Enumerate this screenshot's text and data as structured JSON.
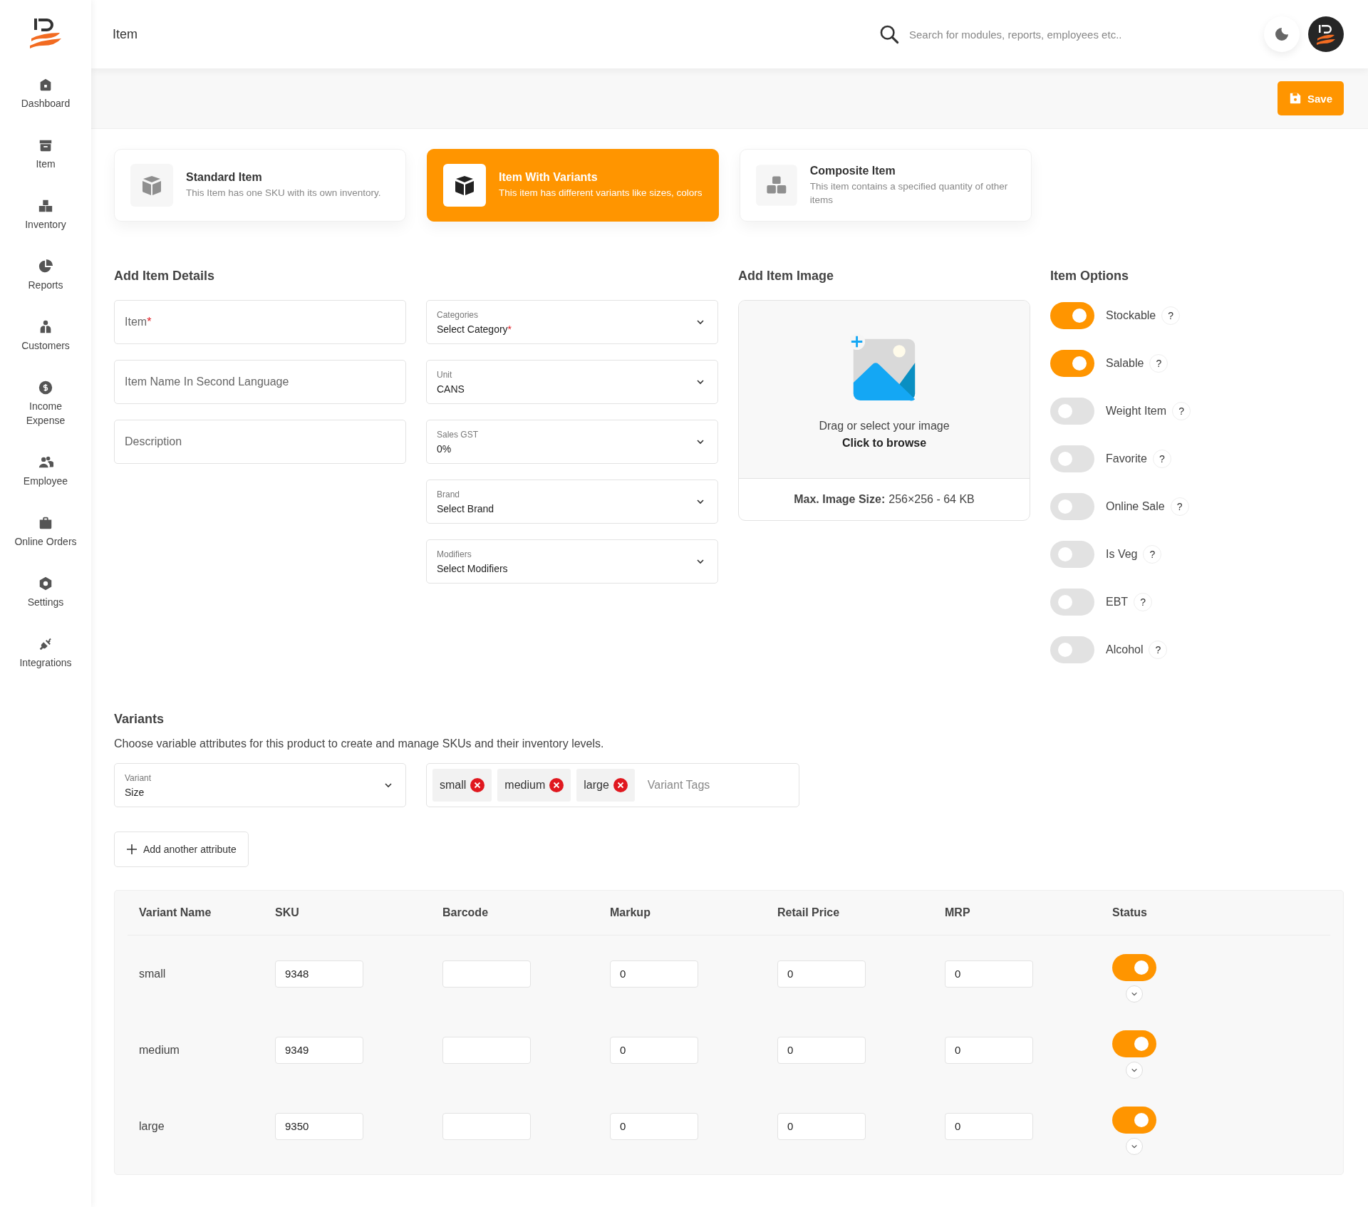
{
  "header": {
    "title": "Item",
    "search": {
      "placeholder": "Search for modules, reports, employees etc.."
    }
  },
  "sidebar": {
    "items": [
      {
        "label": "Dashboard"
      },
      {
        "label": "Item"
      },
      {
        "label": "Inventory"
      },
      {
        "label": "Reports"
      },
      {
        "label": "Customers"
      },
      {
        "label": "Income Expense"
      },
      {
        "label": "Employee"
      },
      {
        "label": "Online Orders"
      },
      {
        "label": "Settings"
      },
      {
        "label": "Integrations"
      }
    ]
  },
  "toolbar": {
    "save_button": "Save"
  },
  "item_types": [
    {
      "title": "Standard Item",
      "description": "This Item has one SKU with its own inventory.",
      "selected": false
    },
    {
      "title": "Item With Variants",
      "description": "This item has different variants like sizes, colors",
      "selected": true
    },
    {
      "title": "Composite Item",
      "description": "This item contains a specified quantity of other items",
      "selected": false
    }
  ],
  "details": {
    "title": "Add Item Details",
    "fields": [
      {
        "placeholder": "Item",
        "mark": "*"
      },
      {
        "placeholder": "Item Name In Second Language"
      },
      {
        "placeholder": "Description"
      }
    ],
    "selects": [
      {
        "label": "Categories",
        "value": "Select Category",
        "mark": "*"
      },
      {
        "label": "Unit",
        "value": "CANS"
      },
      {
        "label": "Sales GST",
        "value": "0%"
      },
      {
        "label": "Brand",
        "value": "Select Brand"
      },
      {
        "label": "Modifiers",
        "value": "Select Modifiers"
      }
    ]
  },
  "image": {
    "title": "Add Item Image",
    "hint": "Drag or select your image",
    "browse": "Click to browse",
    "size_label": "Max. Image Size:",
    "size_value": "256×256 - 64 KB"
  },
  "options": {
    "title": "Item Options",
    "items": [
      {
        "label": "Stockable",
        "on": true,
        "help": "?"
      },
      {
        "label": "Salable",
        "on": true,
        "help": "?"
      },
      {
        "label": "Weight Item",
        "on": false,
        "help": "?"
      },
      {
        "label": "Favorite",
        "on": false,
        "help": "?"
      },
      {
        "label": "Online Sale",
        "on": false,
        "help": "?"
      },
      {
        "label": "Is Veg",
        "on": false,
        "help": "?"
      },
      {
        "label": "EBT",
        "on": false,
        "help": "?"
      },
      {
        "label": "Alcohol",
        "on": false,
        "help": "?"
      }
    ]
  },
  "variants": {
    "title": "Variants",
    "description": "Choose variable attributes for this product to create and manage SKUs and their inventory levels.",
    "attribute": {
      "label": "Variant",
      "value": "Size"
    },
    "tags": [
      {
        "label": "small"
      },
      {
        "label": "medium"
      },
      {
        "label": "large"
      }
    ],
    "tags_placeholder": "Variant Tags",
    "add_button": "Add another attribute"
  },
  "table": {
    "columns": [
      "Variant Name",
      "SKU",
      "Barcode",
      "Markup",
      "Retail Price",
      "MRP",
      "Status"
    ],
    "rows": [
      {
        "name": "small",
        "sku": "9348",
        "markup": "0",
        "retail_price": "0",
        "mrp": "0",
        "active": true
      },
      {
        "name": "medium",
        "sku": "9349",
        "markup": "0",
        "retail_price": "0",
        "mrp": "0",
        "active": true
      },
      {
        "name": "large",
        "sku": "9350",
        "markup": "0",
        "retail_price": "0",
        "mrp": "0",
        "active": true
      }
    ]
  }
}
